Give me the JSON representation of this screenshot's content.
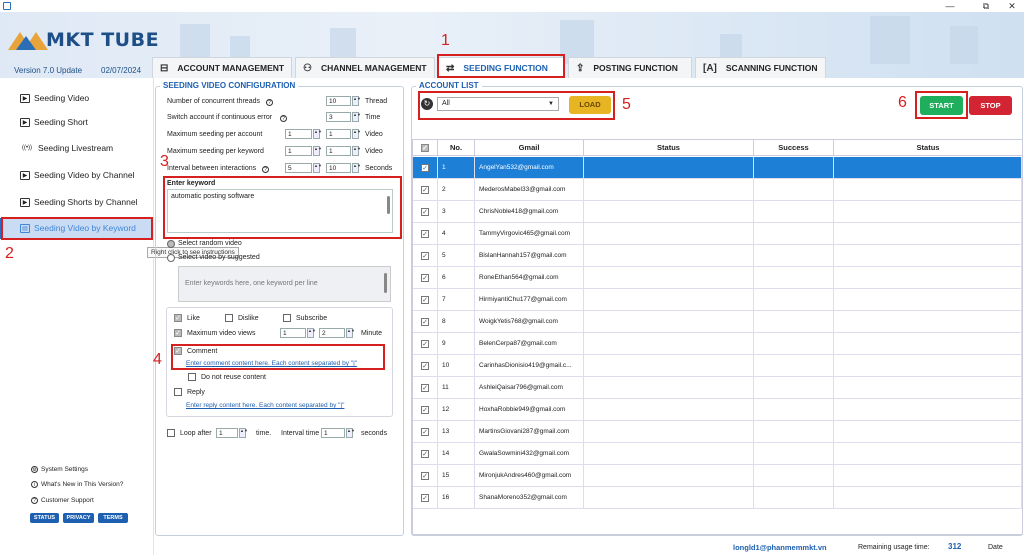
{
  "window": {
    "min": "—",
    "max": "⧉",
    "close": "✕"
  },
  "header": {
    "logo": "MKT TUBE",
    "version": "Version  7.0 Update",
    "date": "02/07/2024"
  },
  "tabs": [
    {
      "icon": "⊟",
      "label": "ACCOUNT MANAGEMENT"
    },
    {
      "icon": "⚇",
      "label": "CHANNEL MANAGEMENT"
    },
    {
      "icon": "⇄",
      "label": "SEEDING FUNCTION"
    },
    {
      "icon": "⇪",
      "label": "POSTING FUNCTION"
    },
    {
      "icon": "[A]",
      "label": "SCANNING FUNCTION"
    }
  ],
  "sidebar": {
    "items": [
      "Seeding Video",
      "Seeding Short",
      "Seeding Livestream",
      "Seeding Video by Channel",
      "Seeding Shorts by Channel",
      "Seeding Video by Keyword"
    ],
    "tooltip": "Right click to see instructions",
    "footer": [
      "System Settings",
      "What's New in This Version?",
      "Customer Support"
    ],
    "pills": [
      "STATUS",
      "PRIVACY",
      "TERMS"
    ]
  },
  "config": {
    "title": "SEEDING VIDEO CONFIGURATION",
    "threads_label": "Number of concurrent threads",
    "threads": "10",
    "threads_unit": "Thread",
    "switch_label": "Switch account if continuous error",
    "switch": "3",
    "switch_unit": "Time",
    "max_acc_label": "Maximum seeding per account",
    "max_acc_a": "1",
    "max_acc_b": "1",
    "max_acc_unit": "Video",
    "max_kw_label": "Maximum seeding per keyword",
    "max_kw_a": "1",
    "max_kw_b": "1",
    "max_kw_unit": "Video",
    "interval_label": "Interval between interactions",
    "interval_a": "5",
    "interval_b": "10",
    "interval_unit": "Seconds",
    "keyword_title": "Enter keyword",
    "keyword_value": "automatic posting software",
    "random": "Select random video",
    "suggested": "Select video by suggested",
    "suggest_placeholder": "Enter keywords here, one keyword per line",
    "like": "Like",
    "dislike": "Dislike",
    "subscribe": "Subscribe",
    "max_views_label": "Maximum video views",
    "max_views_a": "1",
    "max_views_b": "2",
    "max_views_unit": "Minute",
    "comment": "Comment",
    "comment_link": "Enter comment content here. Each content separated by \"|\"",
    "no_reuse": "Do not reuse content",
    "reply": "Reply",
    "reply_link": "Enter reply content here. Each content separated by \"|\"",
    "loop_label": "Loop after",
    "loop": "1",
    "loop_unit": "time.",
    "interval_time_label": "Interval time",
    "interval_time": "1",
    "interval_time_unit": "seconds"
  },
  "accounts": {
    "title": "ACCOUNT LIST",
    "filter": "All",
    "load": "LOAD",
    "start": "START",
    "stop": "STOP",
    "columns": [
      "No.",
      "Gmail",
      "Status",
      "Success",
      "Status"
    ],
    "rows": [
      {
        "no": "1",
        "gmail": "AngelYan532@gmail.com"
      },
      {
        "no": "2",
        "gmail": "MederosMabel33@gmail.com"
      },
      {
        "no": "3",
        "gmail": "ChrisNoble418@gmail.com"
      },
      {
        "no": "4",
        "gmail": "TammyVirgovic465@gmail.com"
      },
      {
        "no": "5",
        "gmail": "BislanHannah157@gmail.com"
      },
      {
        "no": "6",
        "gmail": "RoneEthan564@gmail.com"
      },
      {
        "no": "7",
        "gmail": "HirmiyantiChu177@gmail.com"
      },
      {
        "no": "8",
        "gmail": "WoigkYetis768@gmail.com"
      },
      {
        "no": "9",
        "gmail": "BelenCerpa87@gmail.com"
      },
      {
        "no": "10",
        "gmail": "CarinhasDionisio419@gmail.c..."
      },
      {
        "no": "11",
        "gmail": "AshleiQaisar796@gmail.com"
      },
      {
        "no": "12",
        "gmail": "HoxhaRobbie949@gmail.com"
      },
      {
        "no": "13",
        "gmail": "MartinsGiovani287@gmail.com"
      },
      {
        "no": "14",
        "gmail": "GwalaSowmini432@gmail.com"
      },
      {
        "no": "15",
        "gmail": "MironjukAndres460@gmail.com"
      },
      {
        "no": "16",
        "gmail": "ShanaMoreno352@gmail.com"
      }
    ]
  },
  "statusbar": {
    "email": "longld1@phanmemmkt.vn",
    "remaining_label": "Remaining usage time:",
    "remaining": "312",
    "date_label": "Date"
  },
  "annotations": [
    "1",
    "2",
    "3",
    "4",
    "5",
    "6"
  ],
  "colors": {
    "accent": "#1d5fb0",
    "start": "#1fae5b",
    "stop": "#d32434",
    "load": "#e7b423",
    "annotation": "#d62020",
    "selected_row": "#1e7fd6"
  }
}
